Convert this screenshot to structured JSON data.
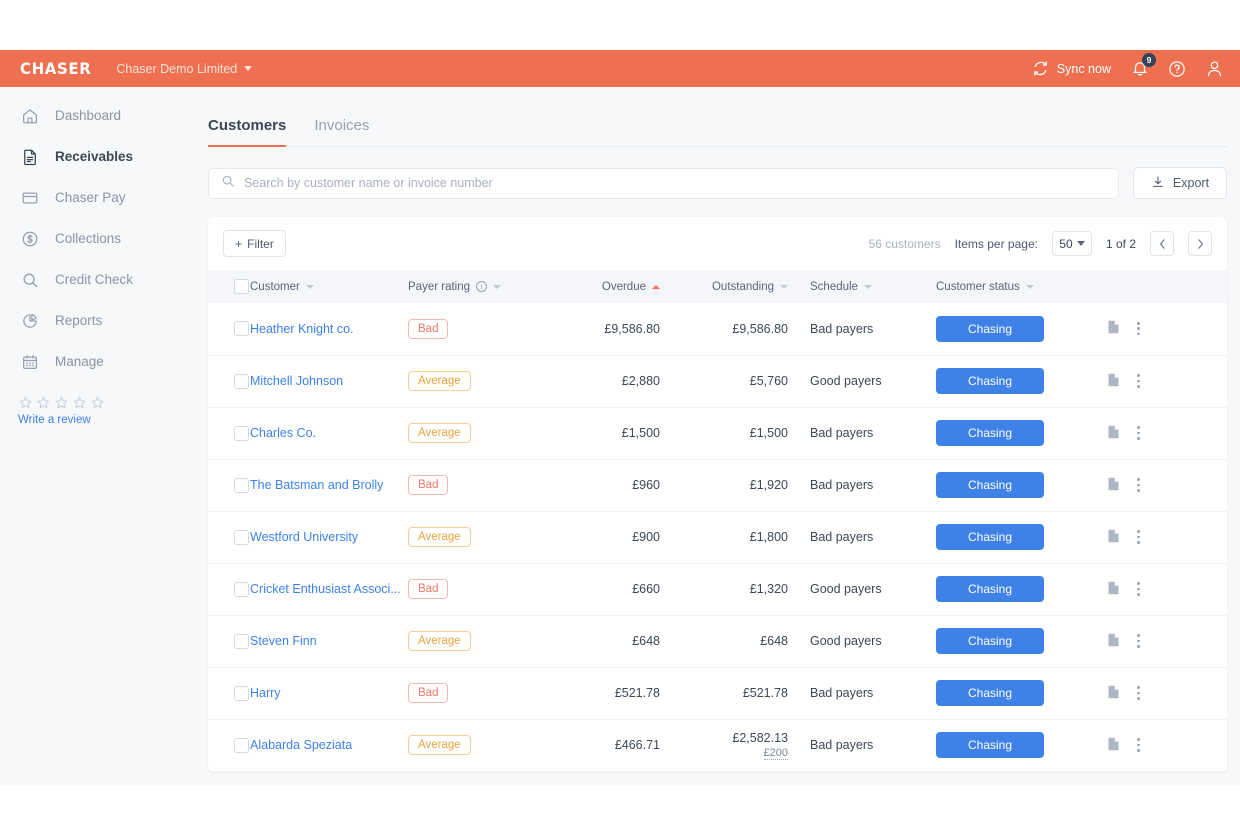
{
  "topbar": {
    "brand": "CHASER",
    "org": "Chaser Demo Limited",
    "sync_label": "Sync now",
    "notification_count": "9",
    "accent_color": "#ef7050"
  },
  "sidebar": {
    "items": [
      {
        "label": "Dashboard",
        "icon": "home-icon",
        "active": false
      },
      {
        "label": "Receivables",
        "icon": "document-icon",
        "active": true
      },
      {
        "label": "Chaser Pay",
        "icon": "card-icon",
        "active": false
      },
      {
        "label": "Collections",
        "icon": "dollar-circle-icon",
        "active": false
      },
      {
        "label": "Credit Check",
        "icon": "search-icon",
        "active": false
      },
      {
        "label": "Reports",
        "icon": "pie-chart-icon",
        "active": false
      },
      {
        "label": "Manage",
        "icon": "calendar-icon",
        "active": false
      }
    ],
    "review": {
      "stars": 5,
      "link_label": "Write a review"
    }
  },
  "tabs": [
    {
      "label": "Customers",
      "active": true
    },
    {
      "label": "Invoices",
      "active": false
    }
  ],
  "search": {
    "placeholder": "Search by customer name or invoice number",
    "value": ""
  },
  "toolbar": {
    "export_label": "Export",
    "filter_label": "Filter",
    "filter_plus": "+",
    "count_label": "56 customers",
    "items_per_page_label": "Items per page:",
    "items_per_page_value": "50",
    "page_label": "1 of 2"
  },
  "table": {
    "columns": [
      {
        "label": "Customer",
        "sortable": true,
        "sorted": "none",
        "align": "left"
      },
      {
        "label": "Payer rating",
        "sortable": true,
        "sorted": "none",
        "align": "left",
        "has_info": true
      },
      {
        "label": "Overdue",
        "sortable": true,
        "sorted": "asc",
        "align": "right"
      },
      {
        "label": "Outstanding",
        "sortable": true,
        "sorted": "none",
        "align": "right"
      },
      {
        "label": "Schedule",
        "sortable": true,
        "sorted": "none",
        "align": "left"
      },
      {
        "label": "Customer status",
        "sortable": true,
        "sorted": "none",
        "align": "left"
      }
    ],
    "rows": [
      {
        "customer": "Heather Knight co.",
        "rating": "Bad",
        "overdue": "£9,586.80",
        "outstanding": "£9,586.80",
        "outstanding_sub": "",
        "schedule": "Bad payers",
        "status": "Chasing"
      },
      {
        "customer": "Mitchell Johnson",
        "rating": "Average",
        "overdue": "£2,880",
        "outstanding": "£5,760",
        "outstanding_sub": "",
        "schedule": "Good payers",
        "status": "Chasing"
      },
      {
        "customer": "Charles Co.",
        "rating": "Average",
        "overdue": "£1,500",
        "outstanding": "£1,500",
        "outstanding_sub": "",
        "schedule": "Bad payers",
        "status": "Chasing"
      },
      {
        "customer": "The Batsman and Brolly",
        "rating": "Bad",
        "overdue": "£960",
        "outstanding": "£1,920",
        "outstanding_sub": "",
        "schedule": "Bad payers",
        "status": "Chasing"
      },
      {
        "customer": "Westford University",
        "rating": "Average",
        "overdue": "£900",
        "outstanding": "£1,800",
        "outstanding_sub": "",
        "schedule": "Bad payers",
        "status": "Chasing"
      },
      {
        "customer": "Cricket Enthusiast Associ...",
        "rating": "Bad",
        "overdue": "£660",
        "outstanding": "£1,320",
        "outstanding_sub": "",
        "schedule": "Good payers",
        "status": "Chasing"
      },
      {
        "customer": "Steven Finn",
        "rating": "Average",
        "overdue": "£648",
        "outstanding": "£648",
        "outstanding_sub": "",
        "schedule": "Good payers",
        "status": "Chasing"
      },
      {
        "customer": "Harry",
        "rating": "Bad",
        "overdue": "£521.78",
        "outstanding": "£521.78",
        "outstanding_sub": "",
        "schedule": "Bad payers",
        "status": "Chasing"
      },
      {
        "customer": "Alabarda Speziata",
        "rating": "Average",
        "overdue": "£466.71",
        "outstanding": "£2,582.13",
        "outstanding_sub": "£200",
        "schedule": "Bad payers",
        "status": "Chasing"
      }
    ]
  },
  "colors": {
    "brand_orange": "#ef7050",
    "link_blue": "#3e82e8",
    "button_blue": "#3e82e8",
    "bad_red": "#ef7a68",
    "average_amber": "#e5a53f",
    "sidebar_bg": "#f7f8fa"
  }
}
